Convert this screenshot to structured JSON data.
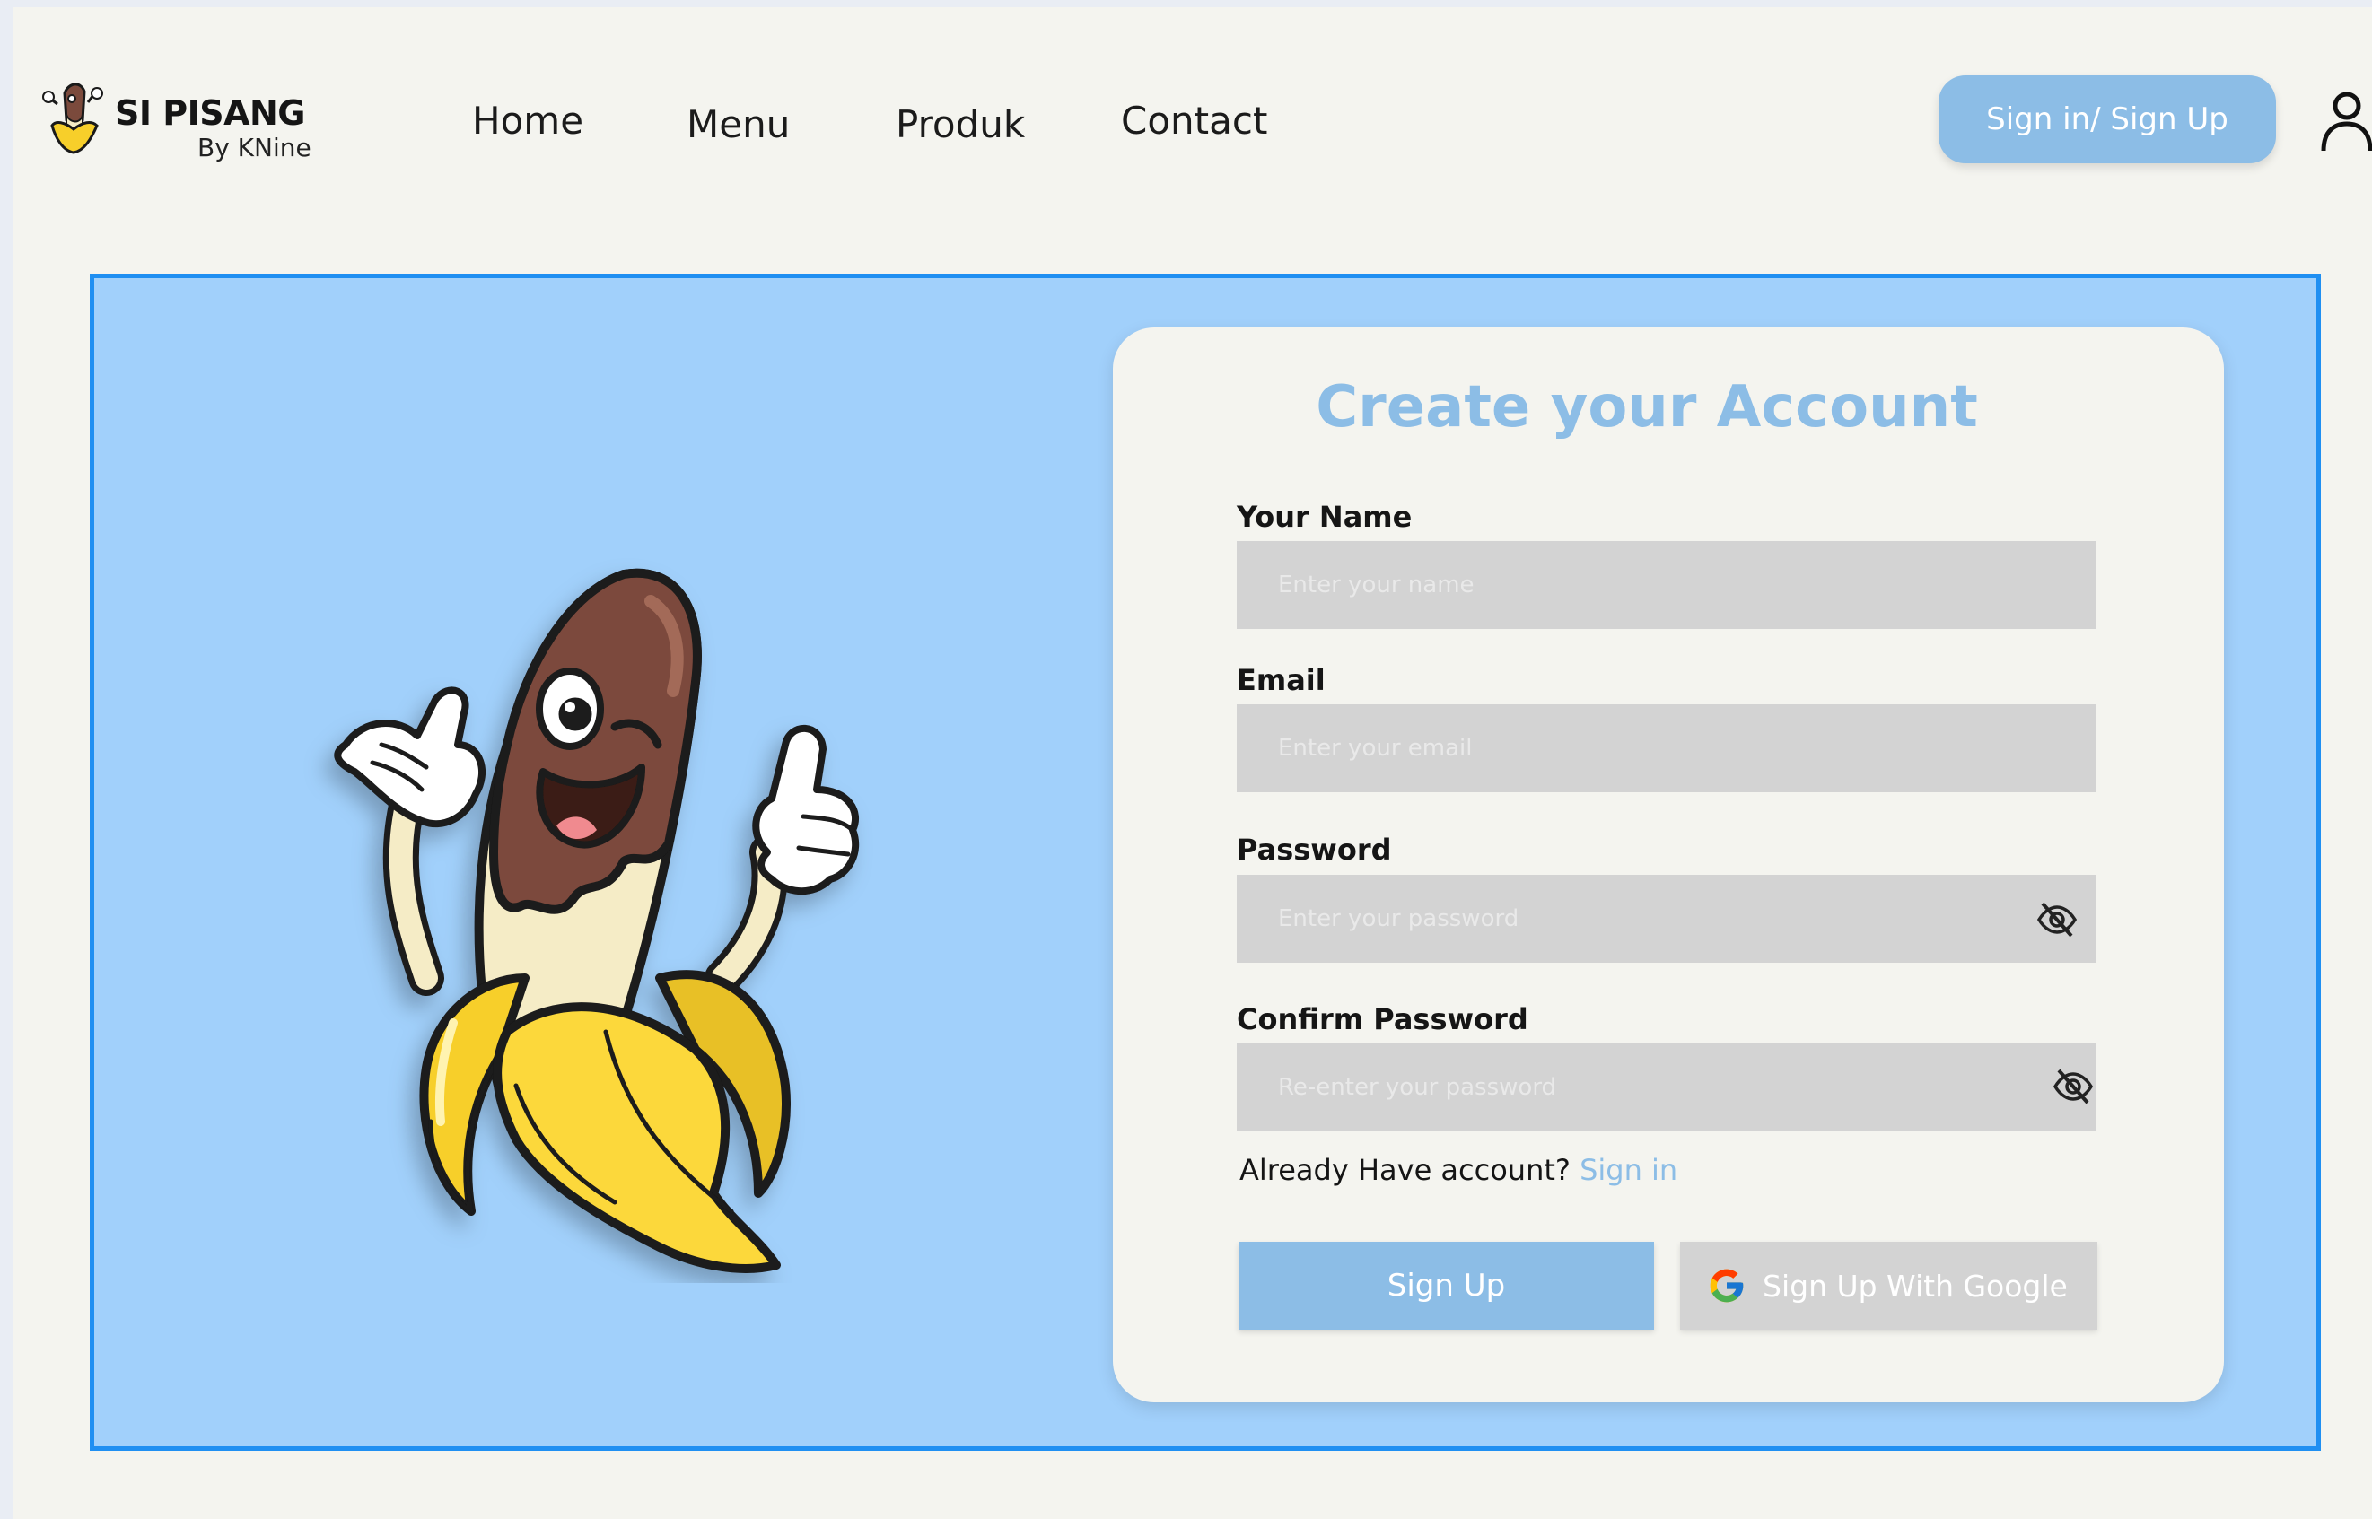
{
  "header": {
    "brand_title": "SI PISANG",
    "brand_sub": "By KNine",
    "nav": [
      "Home",
      "Menu",
      "Produk",
      "Contact"
    ],
    "signin_label": "Sign in/ Sign Up"
  },
  "form": {
    "title": "Create your Account",
    "name_label": "Your Name",
    "name_placeholder": "Enter your name",
    "email_label": "Email",
    "email_placeholder": "Enter your email",
    "password_label": "Password",
    "password_placeholder": "Enter your password",
    "confirm_label": "Confirm Password",
    "confirm_placeholder": "Re-enter your password",
    "already_text": "Already Have account?",
    "signin_link": "Sign in",
    "signup_label": "Sign Up",
    "google_label": "Sign Up With Google"
  },
  "icons": {
    "user": "user-icon",
    "eye": "eye-off-icon",
    "google": "google-icon",
    "logo": "banana-logo"
  },
  "colors": {
    "accent": "#8cbde6",
    "hero_bg": "#a1d0fb",
    "hero_border": "#1f8ff2",
    "page_bg": "#f4f4ef",
    "field_bg": "#d3d3d3"
  }
}
